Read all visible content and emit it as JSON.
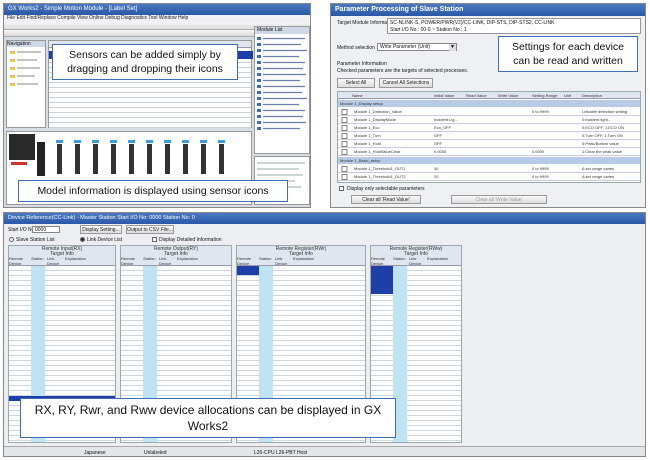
{
  "top_left": {
    "title": "GX Works2 - Simple Motion Module - [Label Set]",
    "menu": "File  Edit  Find/Replace  Compile  View  Online  Debug  Diagnostics  Tool  Window  Help",
    "callout_drag": "Sensors can be added simply by dragging and dropping their icons",
    "callout_model": "Model information is displayed using sensor icons",
    "tree_header": "Module List"
  },
  "top_right": {
    "title": "Parameter Processing of Slave Station",
    "target_label": "Target Module Information",
    "target_value_1": "SC-NLINK-S, POWER/PWR(V2)/CC-LINK, DIP-STS, DIP-STS2, CC-LINK",
    "target_value_2": "Start I/O No.: 00-0 ~ Station No.: 1",
    "method_label": "Method selection",
    "method_value": "Write Parameter (Unit)",
    "param_info_label": "Parameter Information",
    "param_info_desc": "Checked parameters are the targets of selected processes.",
    "select_all": "Select All",
    "cancel_all": "Cancel All Selections",
    "col_name": "Name",
    "col_initial": "Initial Value",
    "col_read": "Read Value",
    "col_write": "Write Value",
    "col_range": "Setting Range",
    "col_unit": "Unit",
    "col_desc": "Description",
    "rows": [
      {
        "name": "Module 1_Display setup",
        "initial": "",
        "range": "",
        "desc": ""
      },
      {
        "name": "Module 1_Detection_Value",
        "initial": "",
        "range": "0 to 9999",
        "desc": "Linkable detection setting"
      },
      {
        "name": "Module 1_DisplayMode",
        "initial": "Incident Lig...",
        "range": "",
        "desc": "0:Incident light..."
      },
      {
        "name": "Module 1_Eco",
        "initial": "Eco_OFF",
        "range": "",
        "desc": "0:ECO OFF, 1:ECO ON"
      },
      {
        "name": "Module 1_Turn",
        "initial": "OFF",
        "range": "",
        "desc": "0:Turn OFF, 1:Turn ON"
      },
      {
        "name": "Module 1_Hold",
        "initial": "OFF",
        "range": "",
        "desc": "0:Peak/Bottom value"
      },
      {
        "name": "Module 1_HoldValueClear",
        "initial": "0.0000",
        "range": "0.0000",
        "desc": "1:Clear the peak value"
      },
      {
        "name": "Module 1_Basic_setup",
        "initial": "",
        "range": "",
        "desc": ""
      },
      {
        "name": "Module 1_Threshold1_OUT1",
        "initial": "40",
        "range": "0 to 9999",
        "desc": "A set range varies"
      },
      {
        "name": "Module 1_Threshold1_OUT2",
        "initial": "20",
        "range": "0 to 9999",
        "desc": "A set range varies"
      }
    ],
    "display_only": "Display only selectable parameters",
    "clear_read": "Clear all 'Read Value'",
    "clear_write": "Clear all 'Write Value'",
    "callout_settings": "Settings for each device can be read and written"
  },
  "bottom": {
    "title": "Device Reference(CC-Link) - Master Station Start I/O No: 0000 Station No: 0",
    "display_unit_label": "Start I/O No.",
    "display_unit_value": "0000",
    "btn_display": "Display Setting...",
    "btn_output": "Output to CSV File...",
    "radio_1": "Slave Station List",
    "radio_2": "Link Device List",
    "check_1": "Display Detailed Information",
    "tables": [
      {
        "title": "Remote Input(RX)",
        "sub": "Target Info",
        "h1": "Remote Device",
        "h2": "Station",
        "h3": "Link Device",
        "h4": "Explanation"
      },
      {
        "title": "Remote Output(RY)",
        "sub": "Target Info",
        "h1": "Remote Device",
        "h2": "Station",
        "h3": "Link Device",
        "h4": "Explanation"
      },
      {
        "title": "Remote Register(RWr)",
        "sub": "Target Info",
        "h1": "Remote Device",
        "h2": "Station",
        "h3": "Link Device",
        "h4": "Explanation"
      },
      {
        "title": "Remote Register(RWw)",
        "sub": "Target Info",
        "h1": "Remote Device",
        "h2": "Station",
        "h3": "Link Device",
        "h4": "Explanation"
      }
    ],
    "status_left": "Japanese",
    "status_mid": "Unlabeled",
    "status_right": "L26-CPU L26-PBT  Host",
    "callout_alloc": "RX, RY, Rwr, and Rww device allocations can be displayed in GX Works2"
  },
  "colors": {
    "callout_border": "#3d6fb5",
    "window_title": "#2a58a8",
    "selection": "#1f3fa8",
    "station_column": "#bfe3f3"
  }
}
